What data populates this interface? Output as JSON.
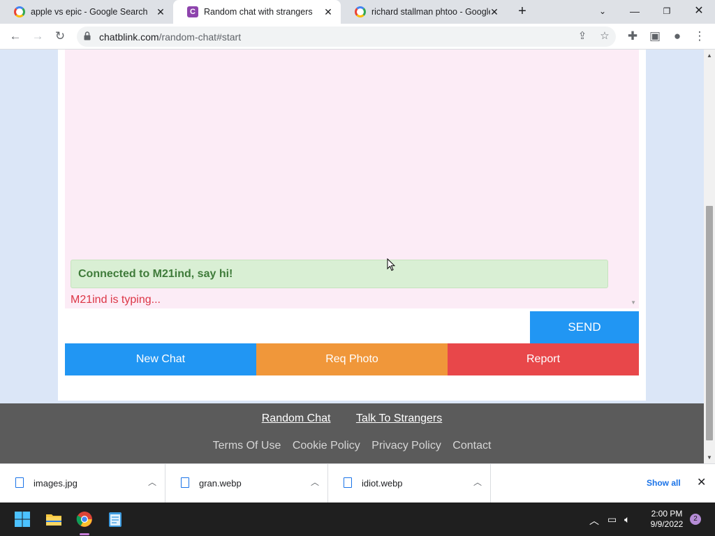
{
  "browser": {
    "tabs": [
      {
        "title": "apple vs epic - Google Search",
        "favicon": "google-icon"
      },
      {
        "title": "Random chat with strangers",
        "favicon": "chatblink-icon",
        "active": true
      },
      {
        "title": "richard stallman phtoo - Google",
        "favicon": "google-icon"
      }
    ],
    "url_domain": "chatblink.com",
    "url_path": "/random-chat#start"
  },
  "chat": {
    "connected_message": "Connected to M21ind, say hi!",
    "typing_status": "M21ind is typing...",
    "input_value": "",
    "send_label": "SEND",
    "new_chat_label": "New Chat",
    "req_photo_label": "Req Photo",
    "report_label": "Report"
  },
  "footer": {
    "primary_links": [
      "Random Chat",
      "Talk To Strangers"
    ],
    "secondary_links": [
      "Terms Of Use",
      "Cookie Policy",
      "Privacy Policy",
      "Contact"
    ]
  },
  "downloads": {
    "items": [
      "images.jpg",
      "gran.webp",
      "idiot.webp"
    ],
    "show_all_label": "Show all"
  },
  "taskbar": {
    "time": "2:00 PM",
    "date": "9/9/2022",
    "notification_count": "2"
  },
  "colors": {
    "send": "#2196f3",
    "new_chat": "#2196f3",
    "req_photo": "#f0973a",
    "report": "#e8474a",
    "connected_bg": "#d9efd4",
    "typing": "#dc3545"
  }
}
